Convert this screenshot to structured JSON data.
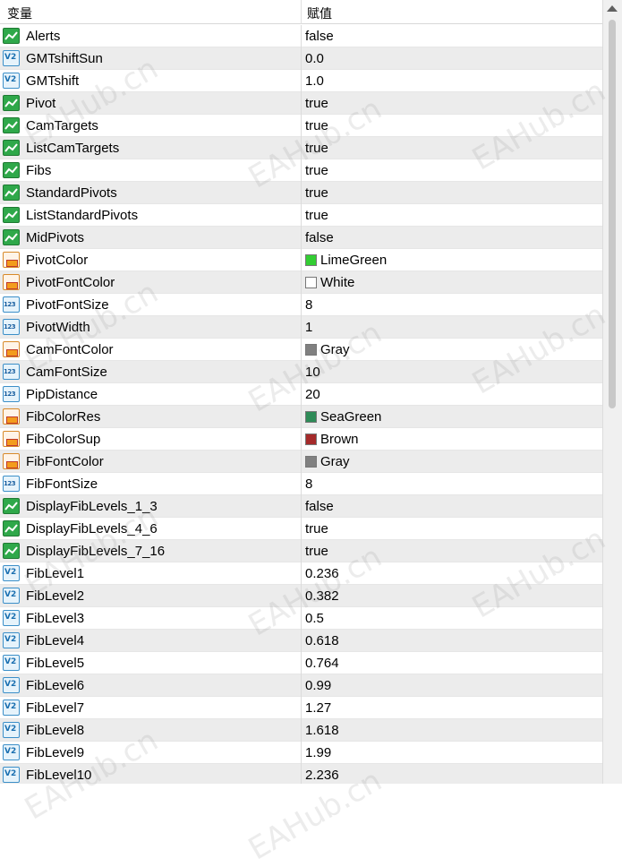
{
  "header": {
    "col_variable": "变量",
    "col_value": "赋值"
  },
  "rows": [
    {
      "name": "Alerts",
      "value": "false",
      "type": "bool"
    },
    {
      "name": "GMTshiftSun",
      "value": "0.0",
      "type": "double"
    },
    {
      "name": "GMTshift",
      "value": "1.0",
      "type": "double"
    },
    {
      "name": "Pivot",
      "value": "true",
      "type": "bool"
    },
    {
      "name": "CamTargets",
      "value": "true",
      "type": "bool"
    },
    {
      "name": "ListCamTargets",
      "value": "true",
      "type": "bool"
    },
    {
      "name": "Fibs",
      "value": "true",
      "type": "bool"
    },
    {
      "name": "StandardPivots",
      "value": "true",
      "type": "bool"
    },
    {
      "name": "ListStandardPivots",
      "value": "true",
      "type": "bool"
    },
    {
      "name": "MidPivots",
      "value": "false",
      "type": "bool"
    },
    {
      "name": "PivotColor",
      "value": "LimeGreen",
      "type": "color",
      "swatch": "#32cd32"
    },
    {
      "name": "PivotFontColor",
      "value": "White",
      "type": "color",
      "swatch": "#ffffff"
    },
    {
      "name": "PivotFontSize",
      "value": "8",
      "type": "int"
    },
    {
      "name": "PivotWidth",
      "value": "1",
      "type": "int"
    },
    {
      "name": "CamFontColor",
      "value": "Gray",
      "type": "color",
      "swatch": "#808080"
    },
    {
      "name": "CamFontSize",
      "value": "10",
      "type": "int"
    },
    {
      "name": "PipDistance",
      "value": "20",
      "type": "int"
    },
    {
      "name": "FibColorRes",
      "value": "SeaGreen",
      "type": "color",
      "swatch": "#2e8b57"
    },
    {
      "name": "FibColorSup",
      "value": "Brown",
      "type": "color",
      "swatch": "#a52a2a"
    },
    {
      "name": "FibFontColor",
      "value": "Gray",
      "type": "color",
      "swatch": "#808080"
    },
    {
      "name": "FibFontSize",
      "value": "8",
      "type": "int"
    },
    {
      "name": "DisplayFibLevels_1_3",
      "value": "false",
      "type": "bool"
    },
    {
      "name": "DisplayFibLevels_4_6",
      "value": "true",
      "type": "bool"
    },
    {
      "name": "DisplayFibLevels_7_16",
      "value": "true",
      "type": "bool"
    },
    {
      "name": "FibLevel1",
      "value": "0.236",
      "type": "double"
    },
    {
      "name": "FibLevel2",
      "value": "0.382",
      "type": "double"
    },
    {
      "name": "FibLevel3",
      "value": "0.5",
      "type": "double"
    },
    {
      "name": "FibLevel4",
      "value": "0.618",
      "type": "double"
    },
    {
      "name": "FibLevel5",
      "value": "0.764",
      "type": "double"
    },
    {
      "name": "FibLevel6",
      "value": "0.99",
      "type": "double"
    },
    {
      "name": "FibLevel7",
      "value": "1.27",
      "type": "double"
    },
    {
      "name": "FibLevel8",
      "value": "1.618",
      "type": "double"
    },
    {
      "name": "FibLevel9",
      "value": "1.99",
      "type": "double"
    },
    {
      "name": "FibLevel10",
      "value": "2.236",
      "type": "double"
    }
  ],
  "icons": {
    "bool": "boolean-icon",
    "double": "double-icon",
    "int": "integer-icon",
    "color": "color-icon"
  },
  "icon_text": {
    "double": "V2",
    "int": "123"
  },
  "watermark": "EAHub.cn"
}
